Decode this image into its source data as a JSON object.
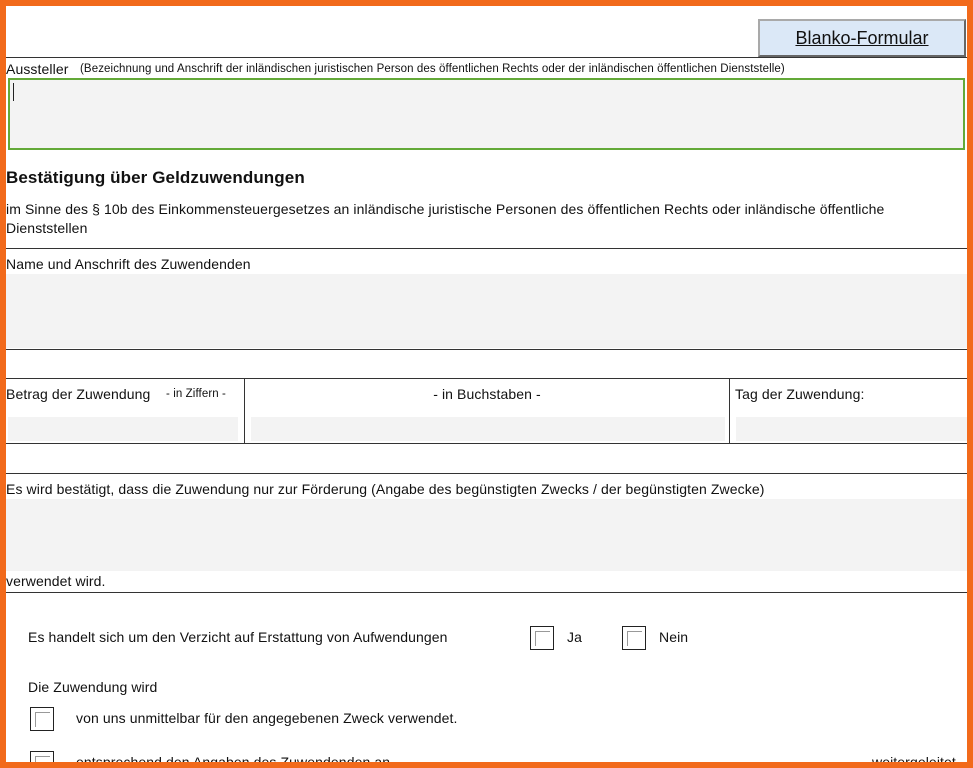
{
  "header_button": "Blanko-Formular",
  "issuer": {
    "label": "Aussteller",
    "hint": "(Bezeichnung und Anschrift der inländischen juristischen Person des öffentlichen Rechts oder der inländischen öffentlichen Dienststelle)",
    "value": ""
  },
  "title": "Bestätigung über Geldzuwendungen",
  "intro_line1": "im Sinne des § 10b des Einkommensteuergesetzes an inländische juristische Personen des öffentlichen Rechts oder inländische öffentliche",
  "intro_line2": "Dienststellen",
  "donor": {
    "label": "Name und Anschrift des Zuwendenden",
    "value": ""
  },
  "amount": {
    "label": "Betrag der Zuwendung",
    "digits_hint": "- in Ziffern -",
    "words_label": "- in Buchstaben -",
    "date_label": "Tag der Zuwendung:"
  },
  "purpose": {
    "label": "Es wird bestätigt, dass die Zuwendung nur zur Förderung (Angabe des begünstigten Zwecks / der begünstigten Zwecke)",
    "footer": "verwendet wird."
  },
  "waiver": {
    "question": "Es handelt sich um den Verzicht auf Erstattung von Aufwendungen",
    "yes": "Ja",
    "no": "Nein"
  },
  "usage": {
    "label": "Die Zuwendung wird",
    "option1": "von uns unmittelbar für den angegebenen Zweck verwendet.",
    "option2": "entsprechend den Angaben des Zuwendenden an",
    "option2_end": "weitergeleitet"
  }
}
